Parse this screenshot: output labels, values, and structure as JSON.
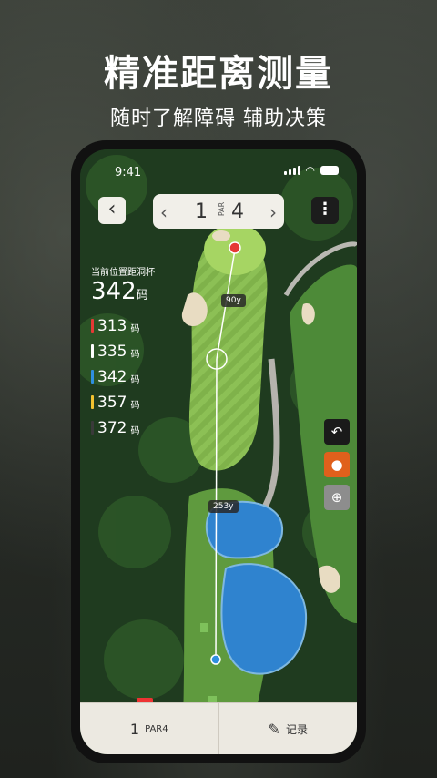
{
  "promo": {
    "headline": "精准距离测量",
    "subline": "随时了解障碍 辅助决策"
  },
  "status_bar": {
    "time": "9:41"
  },
  "nav": {
    "back_icon": "chevron-left-icon",
    "hole_number": "1",
    "par_label": "PAR",
    "par_value": "4",
    "prev_icon": "chevron-left-icon",
    "next_icon": "chevron-right-icon",
    "more_icon": "more-vertical-icon"
  },
  "distances": {
    "caption": "当前位置距洞杯",
    "main_value": "342",
    "main_unit": "码",
    "clubs": [
      {
        "value": "313",
        "unit": "码",
        "color": "#e53935"
      },
      {
        "value": "335",
        "unit": "码",
        "color": "#ffffff"
      },
      {
        "value": "342",
        "unit": "码",
        "color": "#2f8fe0"
      },
      {
        "value": "357",
        "unit": "码",
        "color": "#f2c230"
      },
      {
        "value": "372",
        "unit": "码",
        "color": "#3a3a3a"
      }
    ]
  },
  "map_labels": {
    "label_top": "90y",
    "label_bottom": "253y"
  },
  "side_tools": [
    {
      "icon": "undo-icon",
      "color": "#1a1a1a"
    },
    {
      "icon": "location-pin-icon",
      "color": "#e0601c"
    },
    {
      "icon": "crosshair-icon",
      "color": "#8d8d8d"
    }
  ],
  "bottom_bar": {
    "hole": "1",
    "par": "PAR4",
    "record_label": "记录",
    "record_icon": "edit-note-icon"
  }
}
